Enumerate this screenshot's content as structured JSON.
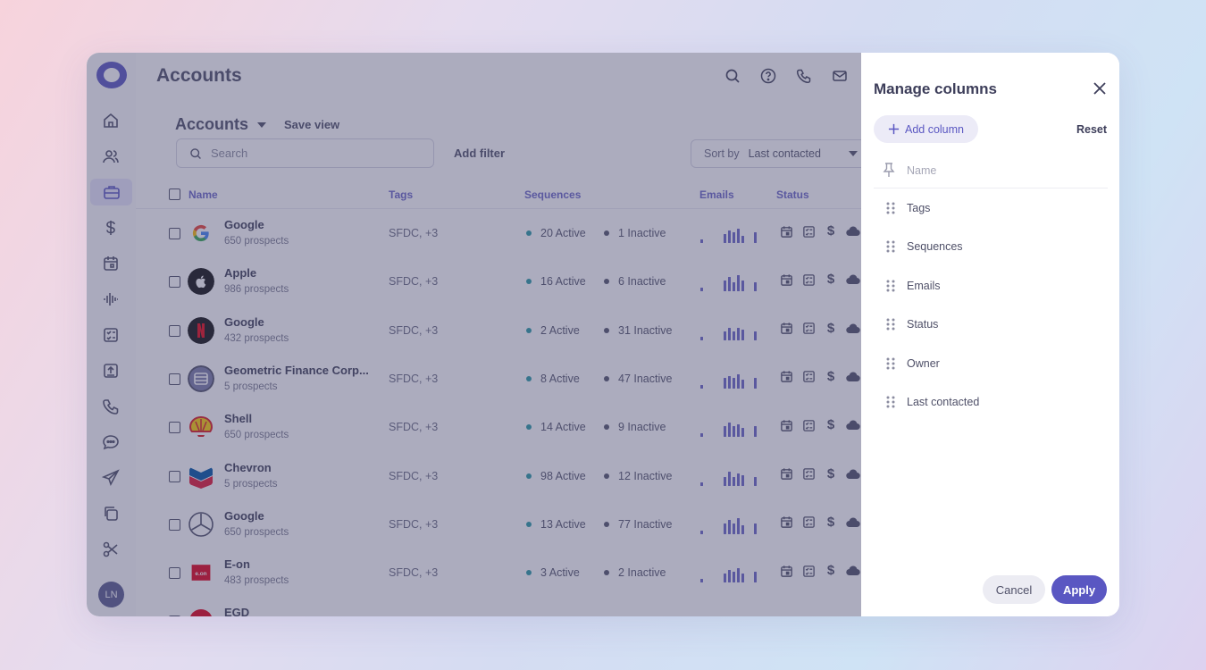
{
  "header": {
    "title": "Accounts"
  },
  "view": {
    "title": "Accounts",
    "save_view": "Save view"
  },
  "search": {
    "placeholder": "Search"
  },
  "filter": {
    "add_filter": "Add filter"
  },
  "sort": {
    "label": "Sort by",
    "value": "Last contacted"
  },
  "table": {
    "headers": {
      "name": "Name",
      "tags": "Tags",
      "sequences": "Sequences",
      "emails": "Emails",
      "status": "Status"
    },
    "rows": [
      {
        "name": "Google",
        "prospects": "650 prospects",
        "logo": "google-logo",
        "tags": "SFDC, +3",
        "active": "20 Active",
        "inactive": "1 Inactive"
      },
      {
        "name": "Apple",
        "prospects": "986 prospects",
        "logo": "apple-logo",
        "tags": "SFDC, +3",
        "active": "16 Active",
        "inactive": "6 Inactive"
      },
      {
        "name": "Google",
        "prospects": "432 prospects",
        "logo": "netflix-logo",
        "tags": "SFDC, +3",
        "active": "2 Active",
        "inactive": "31 Inactive"
      },
      {
        "name": "Geometric Finance Corp...",
        "prospects": "5 prospects",
        "logo": "finance-logo",
        "tags": "SFDC, +3",
        "active": "8 Active",
        "inactive": "47 Inactive"
      },
      {
        "name": "Shell",
        "prospects": "650 prospects",
        "logo": "shell-logo",
        "tags": "SFDC, +3",
        "active": "14 Active",
        "inactive": "9 Inactive"
      },
      {
        "name": "Chevron",
        "prospects": "5 prospects",
        "logo": "chevron-logo",
        "tags": "SFDC, +3",
        "active": "98 Active",
        "inactive": "12 Inactive"
      },
      {
        "name": "Google",
        "prospects": "650 prospects",
        "logo": "mercedes-logo",
        "tags": "SFDC, +3",
        "active": "13 Active",
        "inactive": "77 Inactive"
      },
      {
        "name": "E-on",
        "prospects": "483 prospects",
        "logo": "eon-logo",
        "tags": "SFDC, +3",
        "active": "3 Active",
        "inactive": "2 Inactive"
      },
      {
        "name": "EGD",
        "prospects": "",
        "logo": "egd-logo",
        "tags": "",
        "active": "",
        "inactive": ""
      }
    ]
  },
  "user": {
    "initials": "LN"
  },
  "panel": {
    "title": "Manage columns",
    "add_column": "Add column",
    "reset": "Reset",
    "pinned": "Name",
    "columns": [
      "Tags",
      "Sequences",
      "Emails",
      "Status",
      "Owner",
      "Last contacted"
    ],
    "cancel": "Cancel",
    "apply": "Apply"
  },
  "colors": {
    "accent": "#5a57c2",
    "active_dot": "#2a9aa5",
    "inactive_dot": "#55566c",
    "overlay": "#46466e"
  },
  "icons": {
    "sidebar": [
      "home-icon",
      "users-icon",
      "briefcase-icon",
      "dollar-icon",
      "calendar-icon",
      "waveform-icon",
      "checklist-icon",
      "upload-icon",
      "phone-icon",
      "chat-icon",
      "send-icon",
      "copy-icon",
      "scissors-icon"
    ],
    "top": [
      "search-icon",
      "help-icon",
      "phone-icon",
      "mail-icon"
    ]
  }
}
